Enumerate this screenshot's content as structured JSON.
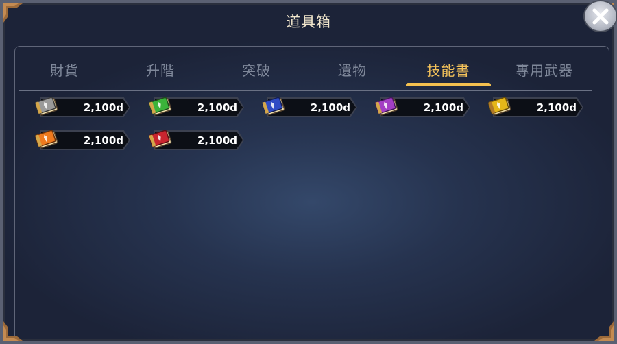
{
  "window": {
    "title": "道具箱"
  },
  "tabs": [
    {
      "label": "財貨",
      "active": false
    },
    {
      "label": "升階",
      "active": false
    },
    {
      "label": "突破",
      "active": false
    },
    {
      "label": "遺物",
      "active": false
    },
    {
      "label": "技能書",
      "active": true
    },
    {
      "label": "專用武器",
      "active": false
    }
  ],
  "colors": {
    "tab_active": "#f2c15a",
    "tab_inactive": "#7f889a",
    "panel_center": "#34486a"
  },
  "items": [
    {
      "icon": "gray-skill-book-icon",
      "color": "#9a9a9a",
      "price": "2,100d"
    },
    {
      "icon": "green-skill-book-icon",
      "color": "#3bb23a",
      "price": "2,100d"
    },
    {
      "icon": "blue-skill-book-icon",
      "color": "#2f4bc4",
      "price": "2,100d"
    },
    {
      "icon": "purple-skill-book-icon",
      "color": "#a33ec4",
      "price": "2,100d"
    },
    {
      "icon": "yellow-skill-book-icon",
      "color": "#e5b619",
      "price": "2,100d"
    },
    {
      "icon": "orange-skill-book-icon",
      "color": "#ee7a1e",
      "price": "2,100d"
    },
    {
      "icon": "red-skill-book-icon",
      "color": "#c9252f",
      "price": "2,100d"
    }
  ]
}
